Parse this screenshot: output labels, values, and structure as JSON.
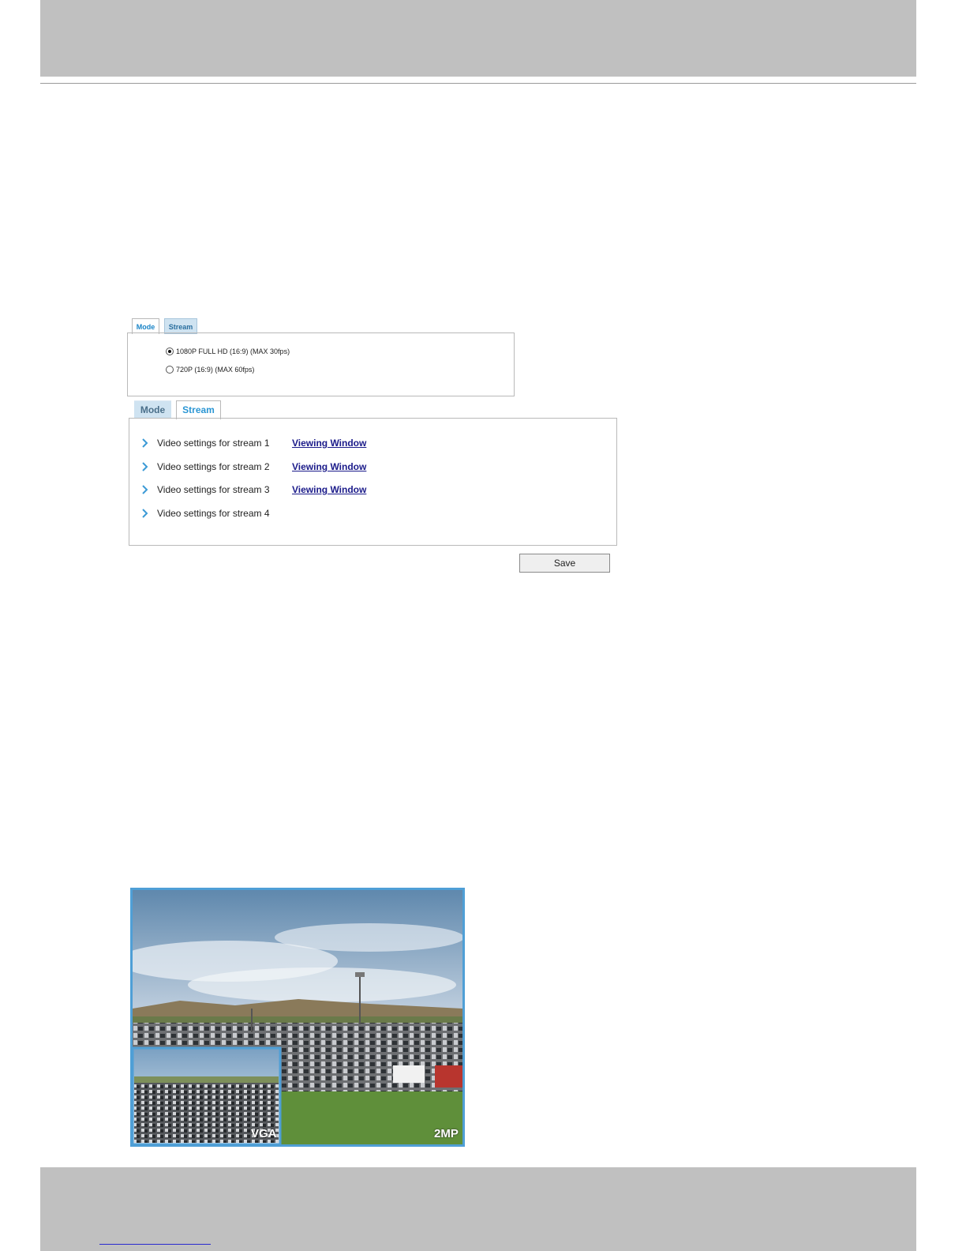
{
  "mode_panel": {
    "tabs": [
      {
        "label": "Mode"
      },
      {
        "label": "Stream"
      }
    ],
    "options": [
      {
        "label": "1080P FULL HD (16:9) (MAX 30fps)",
        "checked": true
      },
      {
        "label": "720P (16:9) (MAX 60fps)",
        "checked": false
      }
    ]
  },
  "stream_panel": {
    "tabs": [
      {
        "label": "Mode"
      },
      {
        "label": "Stream"
      }
    ],
    "rows": [
      {
        "label": "Video settings for stream 1",
        "link": "Viewing Window"
      },
      {
        "label": "Video settings for stream 2",
        "link": "Viewing Window"
      },
      {
        "label": "Video settings for stream 3",
        "link": "Viewing Window"
      },
      {
        "label": "Video settings for stream 4"
      }
    ],
    "save_label": "Save"
  },
  "camera_image": {
    "inset_label": "VGA",
    "main_label": "2MP"
  },
  "colors": {
    "header_band": "#c0c0c0",
    "tab_active_text": "#2b96d4",
    "link": "#1b1b8a",
    "frame_border": "#4f9fd6"
  }
}
